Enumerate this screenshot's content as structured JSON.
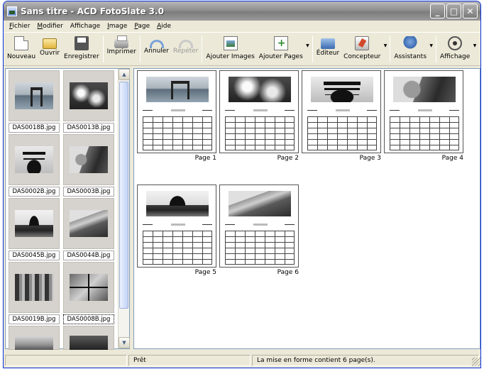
{
  "window": {
    "title": "Sans titre - ACD FotoSlate 3.0"
  },
  "titlebar_buttons": {
    "minimize": "_",
    "maximize": "□",
    "close": "✕"
  },
  "menu": [
    {
      "label": "Fichier",
      "acc": "F",
      "rest": "ichier"
    },
    {
      "label": "Modifier",
      "acc": "M",
      "rest": "odifier"
    },
    {
      "label": "Affichage",
      "acc": "A",
      "rest": "ffichage"
    },
    {
      "label": "Image",
      "acc": "I",
      "rest": "mage"
    },
    {
      "label": "Page",
      "acc": "P",
      "rest": "age"
    },
    {
      "label": "Aide",
      "acc": "A",
      "rest": "ide"
    }
  ],
  "toolbar": {
    "new": "Nouveau",
    "open": "Ouvrir",
    "save": "Enregistrer",
    "print": "Imprimer",
    "undo": "Annuler",
    "redo": "Répéter",
    "add_images": "Ajouter Images",
    "add_pages": "Ajouter Pages",
    "editor": "Éditeur",
    "designer": "Concepteur",
    "wizards": "Assistants",
    "view": "Affichage"
  },
  "thumbnails": [
    {
      "name": "DAS0018B.jpg",
      "photo": "ph-torii"
    },
    {
      "name": "DAS0013B.jpg",
      "photo": "ph-cherry"
    },
    {
      "name": "DAS0002B.jpg",
      "photo": "ph-pagoda"
    },
    {
      "name": "DAS0003B.jpg",
      "photo": "ph-buddha"
    },
    {
      "name": "DAS0045B.jpg",
      "photo": "ph-temple"
    },
    {
      "name": "DAS0044B.jpg",
      "photo": "ph-mountain"
    },
    {
      "name": "DAS0019B.jpg",
      "photo": "ph-street"
    },
    {
      "name": "DAS0008B.jpg",
      "photo": "ph-window"
    }
  ],
  "pages": [
    {
      "label": "Page 1",
      "photo": "ph-torii"
    },
    {
      "label": "Page 2",
      "photo": "ph-cherry"
    },
    {
      "label": "Page 3",
      "photo": "ph-pagoda"
    },
    {
      "label": "Page 4",
      "photo": "ph-buddha"
    },
    {
      "label": "Page 5",
      "photo": "ph-temple"
    },
    {
      "label": "Page 6",
      "photo": "ph-mountain"
    }
  ],
  "status": {
    "left": "",
    "state": "Prêt",
    "info": "La mise en forme contient 6 page(s)."
  },
  "scroll": {
    "up": "▲",
    "down": "▼"
  }
}
